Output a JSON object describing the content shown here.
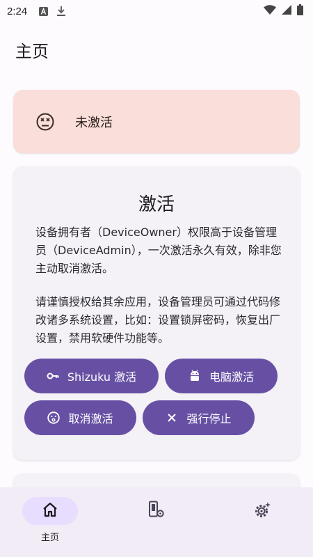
{
  "status_bar": {
    "time": "2:24",
    "left_icons": [
      "font-a-icon",
      "download-icon"
    ],
    "right_icons": [
      "wifi-icon",
      "signal-icon",
      "battery-icon"
    ]
  },
  "page": {
    "title": "主页"
  },
  "status_card": {
    "icon": "dizzy-face-icon",
    "text": "未激活",
    "background": "#f9ded9"
  },
  "activate_card": {
    "title": "激活",
    "paragraph1": "设备拥有者（DeviceOwner）权限高于设备管理员（DeviceAdmin），一次激活永久有效，除非您主动取消激活。",
    "paragraph2": "请谨慎授权给其余应用，设备管理员可通过代码修改诸多系统设置，比如：设置锁屏密码，恢复出厂设置，禁用软硬件功能等。",
    "buttons": {
      "shizuku": {
        "label": "Shizuku 激活",
        "icon": "key-icon"
      },
      "pc": {
        "label": "电脑激活",
        "icon": "android-icon"
      },
      "cancel": {
        "label": "取消激活",
        "icon": "sad-face-icon"
      },
      "force_stop": {
        "label": "强行停止",
        "icon": "close-icon"
      }
    }
  },
  "bottom_nav": {
    "items": [
      {
        "label": "主页",
        "icon": "home-icon",
        "selected": true
      },
      {
        "label": "",
        "icon": "apps-settings-icon",
        "selected": false
      },
      {
        "label": "",
        "icon": "gear-sparkle-icon",
        "selected": false
      }
    ]
  },
  "colors": {
    "primary": "#6750a4",
    "nav_selected_pill": "#e8ddff",
    "background": "#fefbff"
  }
}
